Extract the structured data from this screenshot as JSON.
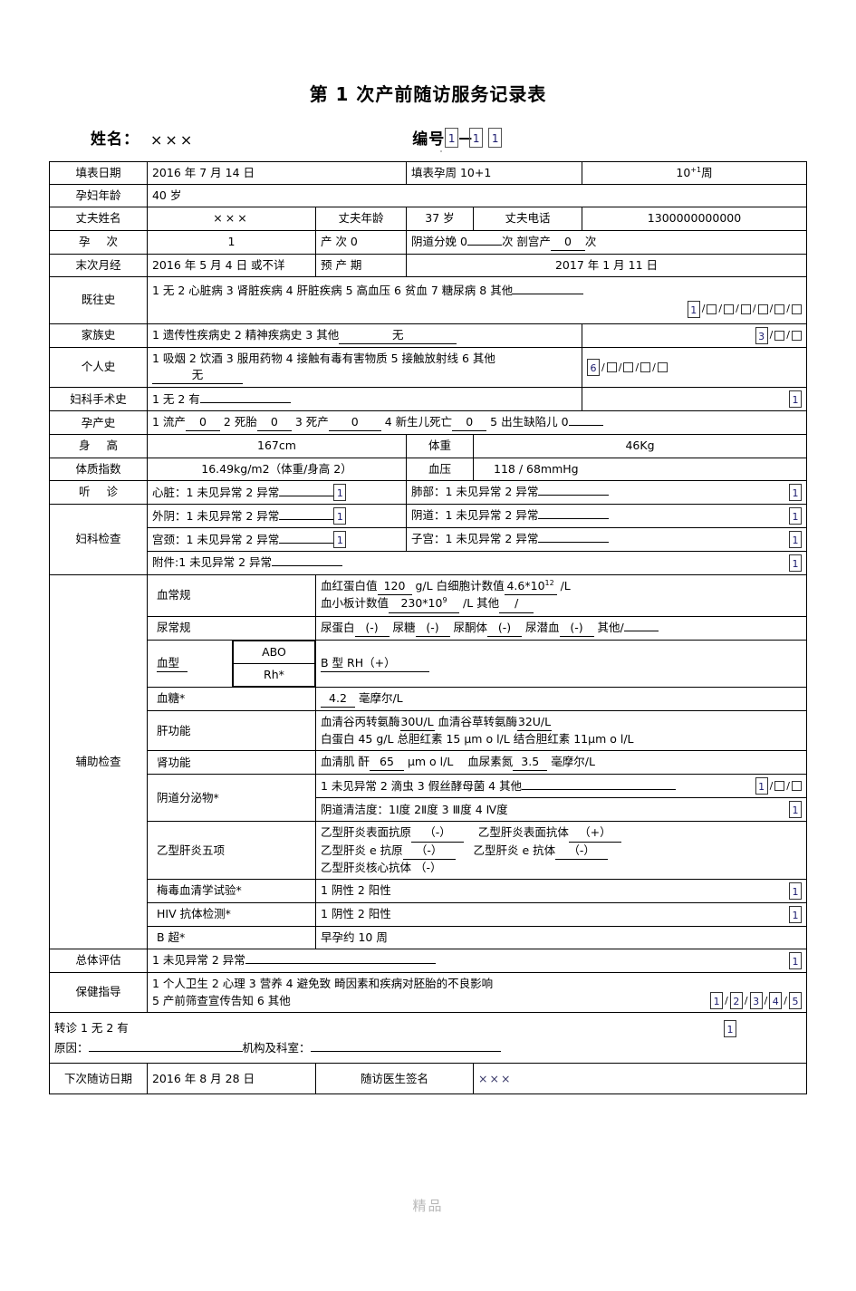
{
  "document": {
    "title": "第 1 次产前随访服务记录表",
    "watermark": "精品"
  },
  "header": {
    "name_label": "姓名：",
    "name_value": "×××",
    "number_label": "编号",
    "number_boxes": [
      "1",
      "1",
      "1"
    ],
    "number_separator": "—"
  },
  "rows": {
    "fill_date_label": "填表日期",
    "fill_date_value": "2016 年 7 月  14 日",
    "fill_week_label": "填表孕周 10+1",
    "fill_week_value_base": "10",
    "fill_week_value_sup": "+1",
    "fill_week_value_unit": "周",
    "mother_age_label": "孕妇年龄",
    "mother_age_value": "40 岁",
    "husband_name_label": "丈夫姓名",
    "husband_name_value": "×××",
    "husband_age_label": "丈夫年龄",
    "husband_age_value": "37 岁",
    "husband_phone_label": "丈夫电话",
    "husband_phone_value": "1300000000000",
    "gravidity_label": "孕    次",
    "gravidity_value": "1",
    "parity_label": "产    次 0",
    "delivery_text_a": "阴道分娩 0",
    "delivery_text_b": "次  剖宫产",
    "delivery_value_c": "0",
    "delivery_text_d": "次",
    "lmp_label": "末次月经",
    "lmp_value": "2016 年 5 月 4 日    或不详",
    "edd_label": "预 产 期",
    "edd_value": "2017   年   1 月    11 日",
    "past_history_label": "既往史",
    "past_history_text": "1 无 2 心脏病 3 肾脏疾病 4 肝脏疾病 5 高血压 6 贫血 7 糖尿病 8 其他",
    "past_history_selected": "1",
    "past_history_empty_count": 6,
    "family_history_label": "家族史",
    "family_history_text": "1 遗传性疾病史   2 精神疾病史 3 其他",
    "family_history_fill": "无",
    "family_history_selected": "3",
    "family_history_empty_count": 2,
    "personal_history_label": "个人史",
    "personal_history_text": "1 吸烟      2 饮酒      3 服用药物    4 接触有毒有害物质 5 接触放射线      6 其他",
    "personal_history_fill": "无",
    "personal_history_selected": "6",
    "personal_history_empty_count": 4,
    "gyn_surgery_label": "妇科手术史",
    "gyn_surgery_text": "1 无   2 有",
    "gyn_surgery_selected": "1",
    "obstetric_label": "孕产史",
    "obstetric_a": "1 流产",
    "obstetric_a_v": "0",
    "obstetric_b": "2 死胎",
    "obstetric_b_v": "0",
    "obstetric_c": "3 死产",
    "obstetric_c_v": "0",
    "obstetric_d": "4 新生儿死亡",
    "obstetric_d_v": "0",
    "obstetric_e": "5 出生缺陷儿 0",
    "height_label": "身    高",
    "height_value": "167cm",
    "weight_label": "体重",
    "weight_value": "46Kg",
    "bmi_label": "体质指数",
    "bmi_value": "16.49kg/m2（体重/身高 2）",
    "bp_label": "血压",
    "bp_value": "118        /  68mmHg",
    "auscultation_label": "听    诊",
    "heart_text": "心脏：1 未见异常 2 异常",
    "heart_selected": "1",
    "lung_text": "肺部：1 未见异常 2 异常",
    "lung_selected": "1",
    "gyn_exam_label": "妇科检查",
    "vulva_text": "外阴：1 未见异常 2 异常",
    "vulva_selected": "1",
    "vagina_text": "阴道：1 未见异常 2 异常",
    "vagina_selected": "1",
    "cervix_text": "宫颈：1 未见异常 2 异常",
    "cervix_selected": "1",
    "uterus_text": "子宫：1 未见异常 2 异常",
    "uterus_selected": "1",
    "adnexa_text": "附件:1 未见异常 2 异常",
    "adnexa_selected": "1"
  },
  "aux": {
    "section_label": "辅助检查",
    "blood_routine_label": "血常规",
    "hb_label": "血红蛋白值",
    "hb_value": "120",
    "hb_unit": "g/L",
    "wbc_label": "白细胞计数值",
    "wbc_value": "4.6*10",
    "wbc_sup": "12",
    "wbc_unit": "/L",
    "plt_label": "血小板计数值",
    "plt_value": "230*10",
    "plt_sup": "9",
    "plt_unit": "/L",
    "blood_other_label": "其他",
    "blood_other_value": "/",
    "urine_routine_label": "尿常规",
    "urine_protein_label": "尿蛋白",
    "urine_protein_value": "(-)",
    "urine_sugar_label": "尿糖",
    "urine_sugar_value": "(-)",
    "urine_ketone_label": "尿酮体",
    "urine_ketone_value": "(-)",
    "urine_occult_label": "尿潜血",
    "urine_occult_value": "(-)",
    "urine_other_label": "其他/",
    "blood_type_label": "血型",
    "abo_label": "ABO",
    "rh_label": "Rh*",
    "blood_type_value": "B 型  RH（+）",
    "glucose_label": "血糖*",
    "glucose_value": "4.2",
    "glucose_unit": "毫摩尔/L",
    "liver_label": "肝功能",
    "alt_label": "血清谷丙转氨酶",
    "alt_value": "30U/L",
    "ast_label": "血清谷草转氨酶",
    "ast_value": "32U/L",
    "alb_label": "白蛋白",
    "alb_value": "45 g/L",
    "tbil_label": "总胆红素",
    "tbil_value": "15",
    "tbil_unit": "μm o l/L",
    "dbil_label": "结合胆红素",
    "dbil_value": "11μm o l/L",
    "kidney_label": "肾功能",
    "cr_label": "血清肌 酐",
    "cr_value": "65",
    "cr_unit": "μm o l/L",
    "bun_label": "血尿素氮",
    "bun_value": "3.5",
    "bun_unit": "毫摩尔/L",
    "vaginal_secretion_label": "阴道分泌物*",
    "vaginal_secretion_text": "1 未见异常 2 滴虫 3 假丝酵母菌 4 其他",
    "vaginal_secretion_selected": "1",
    "vaginal_secretion_empty_count": 2,
    "cleanliness_text": "阴道清洁度：1Ⅰ度 2Ⅱ度 3 Ⅲ度 4 Ⅳ度",
    "cleanliness_selected": "1",
    "hbv_label": "乙型肝炎五项",
    "hbsag_label": "乙型肝炎表面抗原",
    "hbsag_value": "（-）",
    "hbsab_label": "乙型肝炎表面抗体",
    "hbsab_value": "（+）",
    "hbeag_label": "乙型肝炎 e 抗原",
    "hbeag_value": "（-）",
    "hbeab_label": "乙型肝炎 e 抗体",
    "hbeab_value": "（-）",
    "hbcab_label": "乙型肝炎核心抗体",
    "hbcab_value": "（-）",
    "syphilis_label": "梅毒血清学试验*",
    "syphilis_text": "1 阴性 2 阳性",
    "syphilis_selected": "1",
    "hiv_label": "HIV 抗体检测*",
    "hiv_text": "1 阴性 2 阳性",
    "hiv_selected": "1",
    "ultrasound_label": "B 超*",
    "ultrasound_value": "早孕约 10 周"
  },
  "assessment": {
    "overall_label": "总体评估",
    "overall_text": "1  未见异常 2 异常",
    "overall_selected": "1",
    "guidance_label": "保健指导",
    "guidance_line1": "1 个人卫生   2 心理      3 营养   4 避免致 畸因素和疾病对胚胎的不良影响",
    "guidance_line2": "5 产前筛查宣传告知      6 其他",
    "guidance_boxes": [
      "1",
      "2",
      "3",
      "4",
      "5"
    ],
    "referral_line1": "转诊    1 无    2 有",
    "referral_selected": "1",
    "referral_reason_label": "原因：",
    "referral_org_label": "机构及科室：",
    "next_visit_label": "下次随访日期",
    "next_visit_value": "2016   年 8 月  28 日",
    "doctor_sign_label": "随访医生签名",
    "doctor_sign_value": "×××"
  }
}
